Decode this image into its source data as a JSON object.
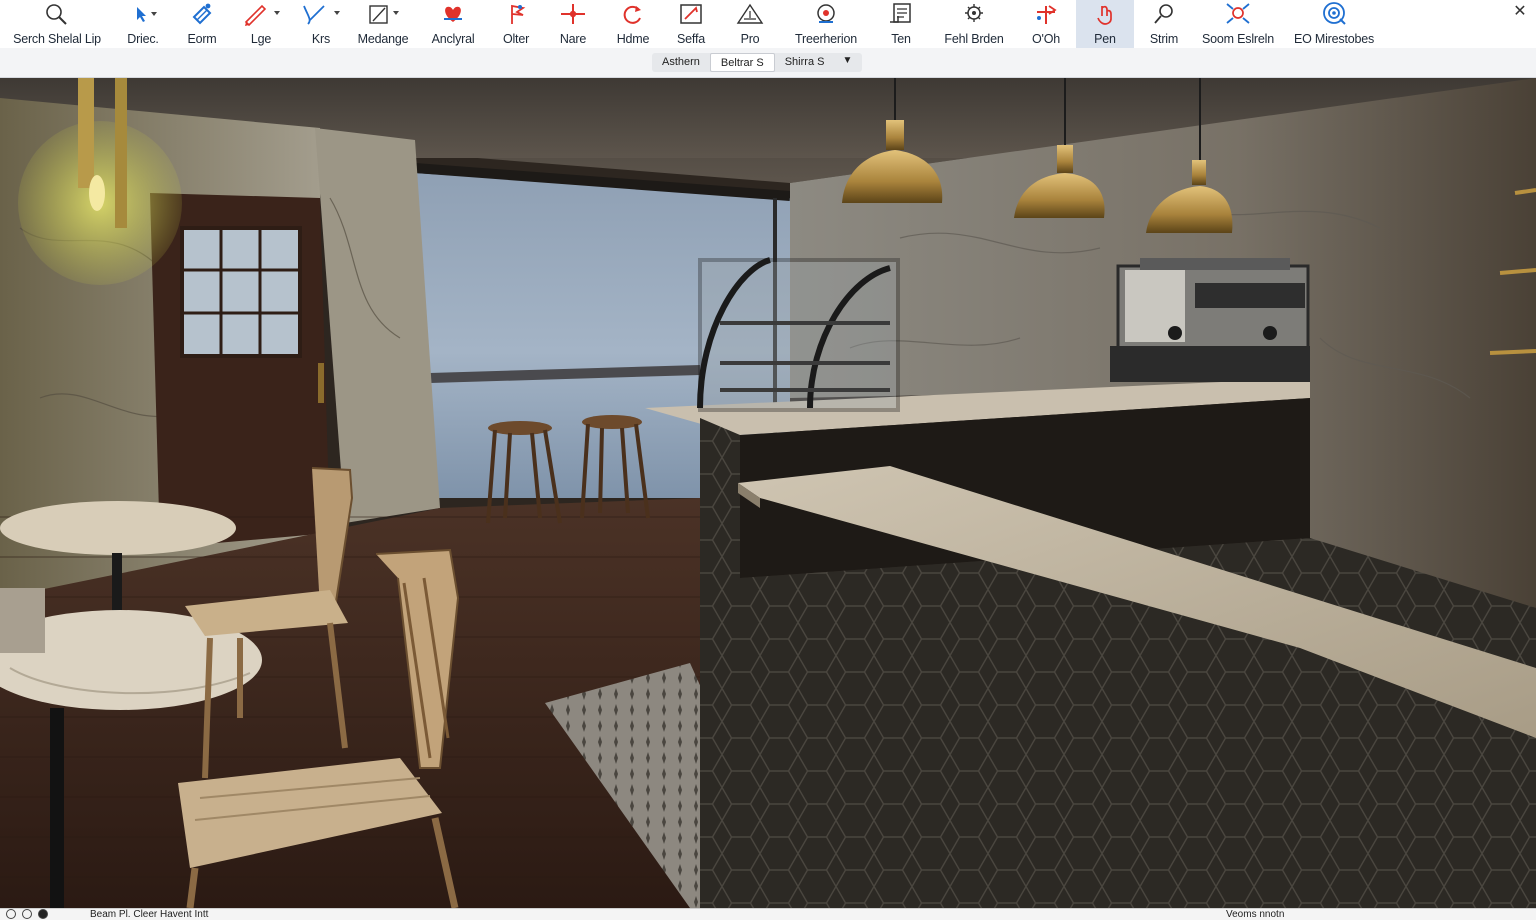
{
  "toolbar": {
    "tools": [
      {
        "label": "Serch Shelal Lip",
        "icon": "magnifier-icon"
      },
      {
        "label": "Driec.",
        "icon": "cursor-icon"
      },
      {
        "label": "Eorm",
        "icon": "eraser-icon"
      },
      {
        "label": "Lge",
        "icon": "pencil-icon"
      },
      {
        "label": "Krs",
        "icon": "pen-curve-icon"
      },
      {
        "label": "Medange",
        "icon": "square-pencil-icon"
      },
      {
        "label": "Anclyral",
        "icon": "heart-pin-icon"
      },
      {
        "label": "Olter",
        "icon": "pin-flag-icon"
      },
      {
        "label": "Nare",
        "icon": "crosshair-icon"
      },
      {
        "label": "Hdme",
        "icon": "rotate-icon"
      },
      {
        "label": "Seffa",
        "icon": "frame-icon"
      },
      {
        "label": "Pro",
        "icon": "triangle-icon"
      },
      {
        "label": "Treerherion",
        "icon": "target-icon"
      },
      {
        "label": "Ten",
        "icon": "notepad-icon"
      },
      {
        "label": "Fehl Brden",
        "icon": "gear-cluster-icon"
      },
      {
        "label": "O'Oh",
        "icon": "split-arrow-icon"
      },
      {
        "label": "Pen",
        "icon": "hand-icon"
      },
      {
        "label": "Strim",
        "icon": "lens-icon"
      },
      {
        "label": "Soom Eslreln",
        "icon": "expand-icon"
      },
      {
        "label": "EO Mirestobes",
        "icon": "globe-icon"
      }
    ],
    "close_symbol": "✕"
  },
  "view_modes": {
    "items": [
      "Asthern",
      "Beltrar S",
      "Shirra S"
    ],
    "selected": "Beltrar S",
    "dropdown_symbol": "▼"
  },
  "statusbar": {
    "text": "Beam Pl. Cleer Havent Intt",
    "right": "Veoms nnotn"
  },
  "colors": {
    "accent_blue": "#1f6fd1",
    "accent_red": "#e0322b",
    "active_tool_bg": "#dbe3ee"
  }
}
